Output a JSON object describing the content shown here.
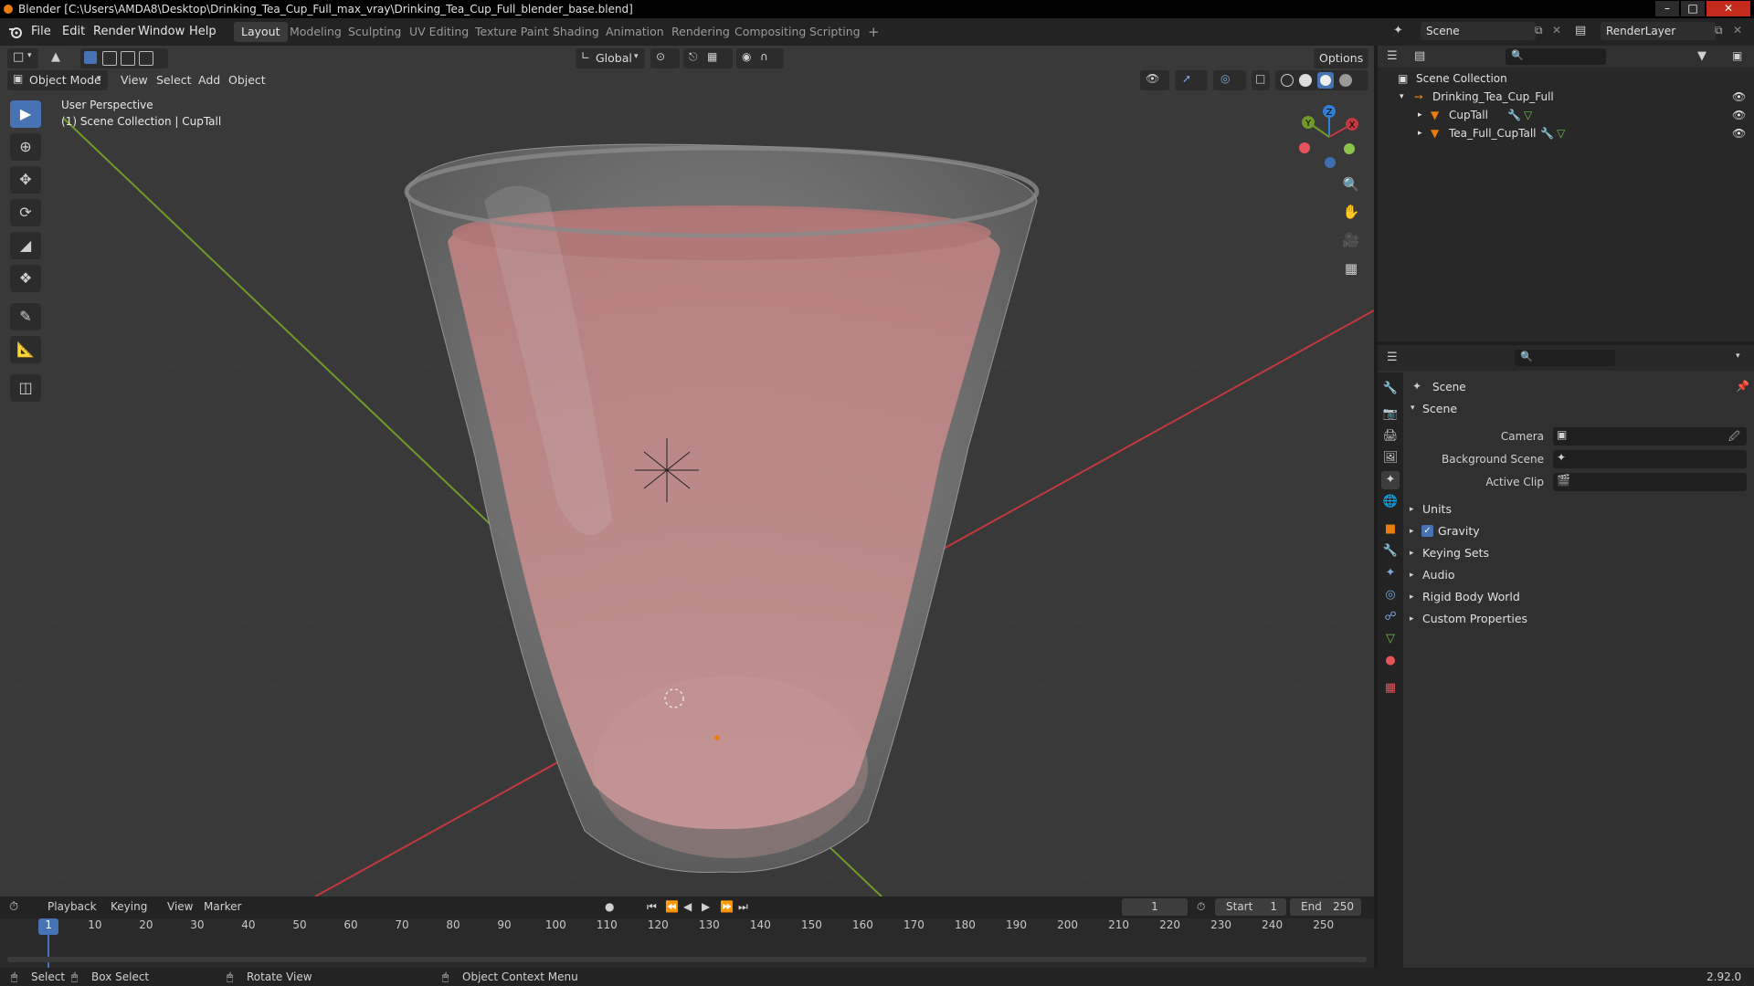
{
  "window": {
    "title": "Blender [C:\\Users\\AMDA8\\Desktop\\Drinking_Tea_Cup_Full_max_vray\\Drinking_Tea_Cup_Full_blender_base.blend]",
    "controls": [
      "–",
      "□",
      "✕"
    ]
  },
  "menu": [
    "File",
    "Edit",
    "Render",
    "Window",
    "Help"
  ],
  "workspaces": [
    "Layout",
    "Modeling",
    "Sculpting",
    "UV Editing",
    "Texture Paint",
    "Shading",
    "Animation",
    "Rendering",
    "Compositing",
    "Scripting",
    "+"
  ],
  "scene_selector": {
    "value": "Scene"
  },
  "renderlayer_selector": {
    "value": "RenderLayer"
  },
  "viewport": {
    "mode": "Object Mode",
    "header_menus": [
      "View",
      "Select",
      "Add",
      "Object"
    ],
    "transform_orientation": "Global",
    "options_label": "Options",
    "overlay_title": "User Perspective",
    "overlay_subtitle": "(1) Scene Collection | CupTall",
    "gizmo": {
      "x": "X",
      "y": "Y",
      "z": "Z"
    }
  },
  "outliner": {
    "rows": [
      {
        "label": "Scene Collection"
      },
      {
        "label": "Drinking_Tea_Cup_Full"
      },
      {
        "label": "CupTall"
      },
      {
        "label": "Tea_Full_CupTall"
      }
    ]
  },
  "properties": {
    "context": "Scene",
    "panel": "Scene",
    "fields": [
      {
        "label": "Camera",
        "value": ""
      },
      {
        "label": "Background Scene",
        "value": ""
      },
      {
        "label": "Active Clip",
        "value": ""
      }
    ],
    "sections": [
      {
        "label": "Units"
      },
      {
        "label": "Gravity",
        "checked": true
      },
      {
        "label": "Keying Sets"
      },
      {
        "label": "Audio"
      },
      {
        "label": "Rigid Body World"
      },
      {
        "label": "Custom Properties"
      }
    ]
  },
  "timeline": {
    "menus": [
      "Playback",
      "Keying",
      "View",
      "Marker"
    ],
    "current_frame": "1",
    "start_label": "Start",
    "start_value": "1",
    "end_label": "End",
    "end_value": "250",
    "ticks": [
      "1",
      "10",
      "20",
      "30",
      "40",
      "50",
      "60",
      "70",
      "80",
      "90",
      "100",
      "110",
      "120",
      "130",
      "140",
      "150",
      "160",
      "170",
      "180",
      "190",
      "200",
      "210",
      "220",
      "230",
      "240",
      "250"
    ]
  },
  "statusbar": {
    "items": [
      "Select",
      "Box Select",
      "Rotate View",
      "Object Context Menu"
    ],
    "version": "2.92.0"
  },
  "colors": {
    "accent": "#4772b3",
    "x_axis": "#c0393d",
    "y_axis": "#6f9a2a",
    "z_axis": "#2f7fd6",
    "object_orange": "#e87d0d"
  }
}
